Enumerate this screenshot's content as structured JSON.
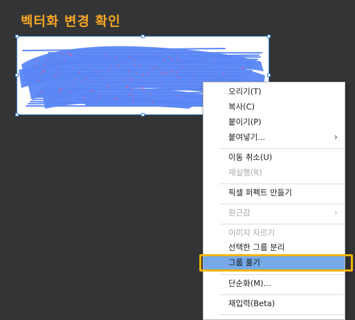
{
  "page": {
    "title": "벡터화 변경 확인"
  },
  "colors": {
    "canvas_background": "#333436",
    "title_color": "#f5a623",
    "selection_color": "#4a90e2",
    "brush_blue": "#5a86f5",
    "brush_pink": "#e0508c",
    "menu_highlight": "#76a9e8",
    "callout_border": "#f5b400"
  },
  "context_menu": {
    "items": [
      {
        "label": "오리기(T)",
        "enabled": true,
        "has_submenu": false
      },
      {
        "label": "복사(C)",
        "enabled": true,
        "has_submenu": false
      },
      {
        "label": "붙이기(P)",
        "enabled": true,
        "has_submenu": false
      },
      {
        "label": "붙여넣기...",
        "enabled": true,
        "has_submenu": true
      },
      {
        "label": "이동 취소(U)",
        "enabled": true,
        "has_submenu": false
      },
      {
        "label": "재실행(R)",
        "enabled": false,
        "has_submenu": false
      },
      {
        "label": "픽셀 퍼펙트 만들기",
        "enabled": true,
        "has_submenu": false
      },
      {
        "label": "원근감",
        "enabled": false,
        "has_submenu": true
      },
      {
        "label": "이미지 자르기",
        "enabled": false,
        "has_submenu": false
      },
      {
        "label": "선택한 그룹 분리",
        "enabled": true,
        "has_submenu": false
      },
      {
        "label": "그룹 풀기",
        "enabled": true,
        "has_submenu": false,
        "highlighted": true
      },
      {
        "label": "단순화(M)...",
        "enabled": true,
        "has_submenu": false
      },
      {
        "label": "재입력(Beta)",
        "enabled": true,
        "has_submenu": false
      }
    ],
    "submenu_arrow": "›"
  }
}
